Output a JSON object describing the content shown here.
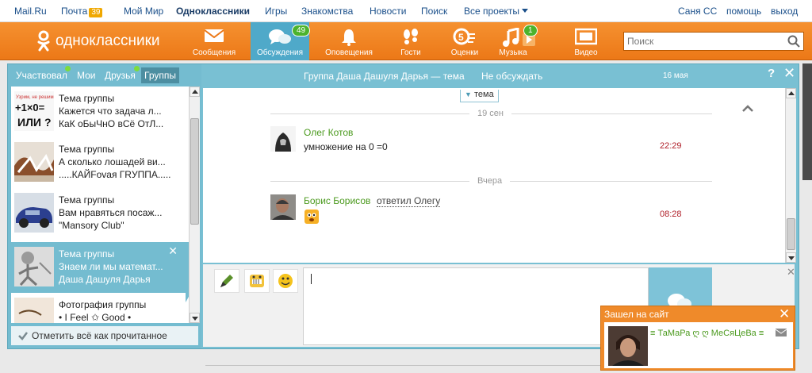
{
  "topbar": {
    "mailru": "Mail.Ru",
    "pochta": "Почта",
    "pochta_count": "39",
    "moi_mir": "Мой Мир",
    "odnoklassniki": "Одноклассники",
    "igry": "Игры",
    "znakomstva": "Знакомства",
    "novosti": "Новости",
    "poisk": "Поиск",
    "vse_proekty": "Все проекты",
    "user": "Саня СС",
    "pomosh": "помощь",
    "vyhod": "выход"
  },
  "header": {
    "logo": "одноклассники",
    "nav": [
      {
        "label": "Сообщения",
        "icon": "envelope-icon"
      },
      {
        "label": "Обсуждения",
        "icon": "chat-bubbles-icon",
        "badge": "49"
      },
      {
        "label": "Оповещения",
        "icon": "bell-icon"
      },
      {
        "label": "Гости",
        "icon": "footprints-icon"
      },
      {
        "label": "Оценки",
        "icon": "rating-icon"
      },
      {
        "label": "Музыка",
        "icon": "music-note-icon",
        "badge": "1"
      },
      {
        "label": "Видео",
        "icon": "film-icon"
      }
    ],
    "search_placeholder": "Поиск"
  },
  "left": {
    "tabs": [
      "Участвовал",
      "Мои",
      "Друзья",
      "Группы"
    ],
    "active_tab": "Группы",
    "items": [
      {
        "lines": [
          "Тема группы",
          "Кажется что задача л...",
          "КаК оБыЧнО вСё ОтЛ..."
        ]
      },
      {
        "lines": [
          "Тема группы",
          "А сколько лошадей ви...",
          ".....КАЙFоvая ГRУППА....."
        ]
      },
      {
        "lines": [
          "Тема группы",
          "Вам нравяться посаж...",
          "\"Mansory Club\""
        ]
      },
      {
        "lines": [
          "Тема группы",
          "Знаем ли мы математ...",
          "Даша Дашуля Дарья"
        ],
        "selected": true
      },
      {
        "lines": [
          "Фотография группы",
          "• I Feel ✩ Good •",
          ""
        ]
      }
    ],
    "mark_all": "Отметить всё как прочитанное"
  },
  "right": {
    "title": "Группа Даша Дашуля Дарья — тема",
    "no_discuss": "Не обсуждать",
    "date": "16 мая",
    "help": "?",
    "topic_label": "тема",
    "messages": [
      {
        "sep": "19 сен",
        "author": "Олег Котов",
        "text": "умножение на 0 =0",
        "time": "22:29"
      },
      {
        "sep": "Вчера",
        "author": "Борис Борисов",
        "reply": "ответил Олегу",
        "text": "",
        "time": "08:28"
      }
    ]
  },
  "notification": {
    "title": "Зашел на сайт",
    "name": "≡ ТаМаРа ღ ღ МеСяЦеВа ≡"
  },
  "colors": {
    "orange": "#ec7817",
    "teal": "#74bcd0",
    "green_text": "#4b9a1e",
    "time_red": "#b0202a"
  }
}
